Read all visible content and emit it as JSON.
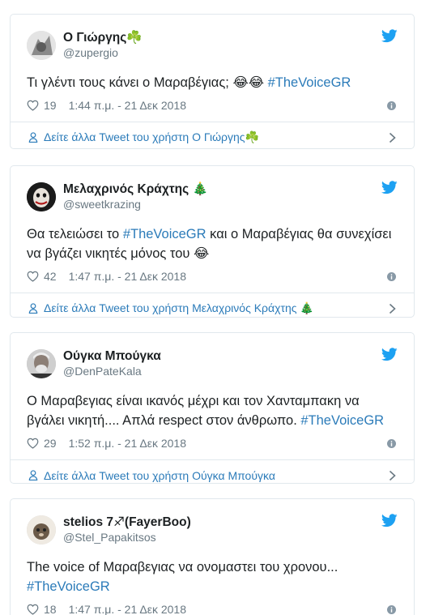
{
  "colors": {
    "link": "#2b7bb9",
    "muted": "#697882",
    "twitter_blue": "#1da1f2",
    "like": "#697882"
  },
  "tweets": [
    {
      "name": "Ο Γιώργης",
      "name_emoji": "☘️",
      "handle": "@zupergio",
      "text_parts": [
        "Τι γλέντι τους κάνει ο Μαραβέγιας; 😂😂 ",
        "#TheVoiceGR"
      ],
      "likes": "19",
      "time": "1:44 π.μ. - 21 Δεκ 2018",
      "footer": "Δείτε άλλα Tweet του χρήστη Ο Γιώργης☘️"
    },
    {
      "name": "Μελαχρινός Κράχτης",
      "name_emoji": "🎄",
      "handle": "@sweetkrazing",
      "text_parts": [
        "Θα τελειώσει το ",
        "#TheVoiceGR",
        " και ο Μαραβέγιας θα συνεχίσει να βγάζει νικητές μόνος του 😂"
      ],
      "likes": "42",
      "time": "1:47 π.μ. - 21 Δεκ 2018",
      "footer": "Δείτε άλλα Tweet του χρήστη Μελαχρινός Κράχτης 🎄"
    },
    {
      "name": "Ούγκα Μπούγκα",
      "name_emoji": "",
      "handle": "@DenPateKala",
      "text_parts": [
        "Ο Μαραβεγιας είναι ικανός μέχρι και τον Χανταμπακη να βγάλει νικητή.... Απλά respect στον άνθρωπο. ",
        "#TheVoiceGR"
      ],
      "likes": "29",
      "time": "1:52 π.μ. - 21 Δεκ 2018",
      "footer": "Δείτε άλλα Tweet του χρήστη Ούγκα Μπούγκα"
    },
    {
      "name": "stelios 7♐(FayerBoo)",
      "name_emoji": "",
      "handle": "@Stel_Papakitsos",
      "text_parts": [
        "The voice of Μαραβεγιας να ονομαστει του χρονου... ",
        "#TheVoiceGR"
      ],
      "likes": "18",
      "time": "1:47 π.μ. - 21 Δεκ 2018",
      "footer": ""
    }
  ]
}
